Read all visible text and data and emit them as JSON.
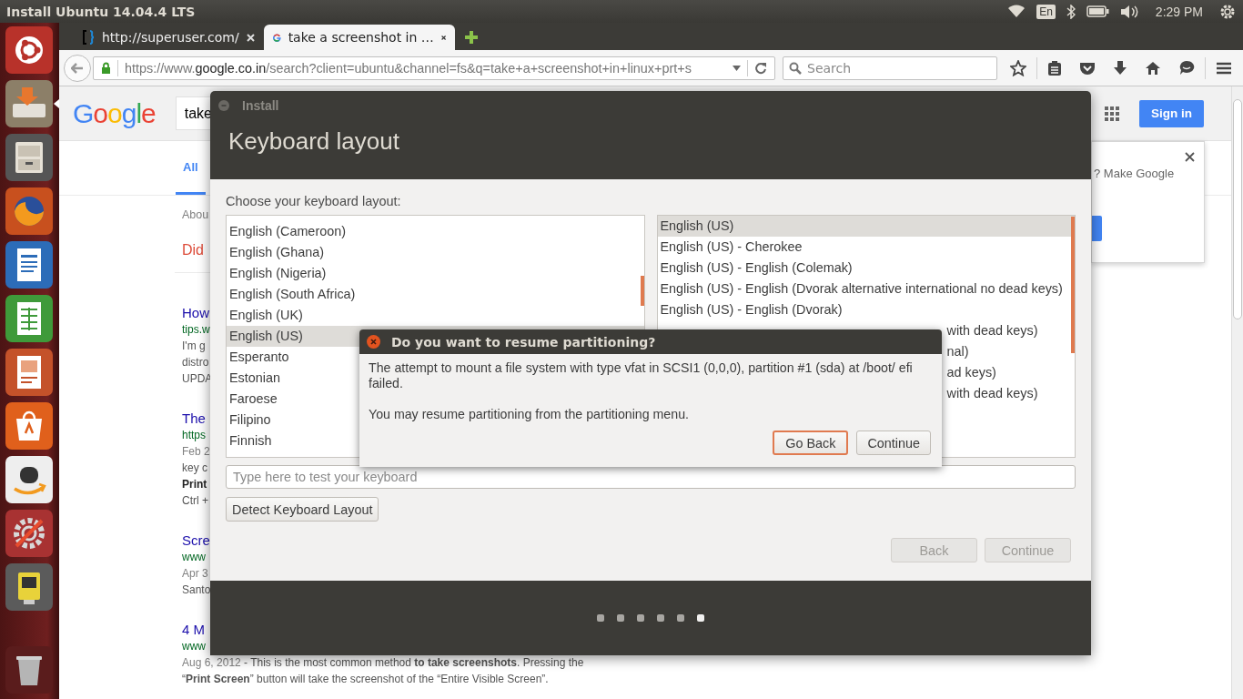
{
  "top_panel": {
    "title": "Install Ubuntu 14.04.4 LTS",
    "keyboard": "En",
    "clock": "2:29 PM"
  },
  "launcher": [
    {
      "kind": "dash",
      "focused": false
    },
    {
      "kind": "installer",
      "focused": true
    },
    {
      "kind": "files",
      "focused": false
    },
    {
      "kind": "firefox",
      "focused": false
    },
    {
      "kind": "writer",
      "focused": false
    },
    {
      "kind": "calc",
      "focused": false
    },
    {
      "kind": "impress",
      "focused": false
    },
    {
      "kind": "software",
      "focused": false
    },
    {
      "kind": "amazon",
      "focused": false
    },
    {
      "kind": "settings",
      "focused": false
    },
    {
      "kind": "drive",
      "focused": false
    },
    {
      "kind": "trash",
      "focused": false
    }
  ],
  "browser": {
    "tabs": [
      {
        "title": "http://superuser.com/",
        "selected": false
      },
      {
        "title": "take a screenshot in …",
        "selected": true
      }
    ],
    "address": {
      "scheme": "https://www.",
      "host": "google.co.in",
      "path": "/search?client=ubuntu&channel=fs&q=take+a+screenshot+in+linux+prt+s"
    },
    "search": {
      "placeholder": "Search"
    }
  },
  "google": {
    "logo": "Google",
    "query": "take",
    "sign_in": "Sign in",
    "tabs": [
      {
        "label": "All",
        "selected": true
      }
    ],
    "stats": "Abou",
    "did_you_mean": "Did",
    "results": [
      {
        "title": "How",
        "url": "tips.w",
        "lines": [
          {
            "text": "I'm g"
          },
          {
            "text": "distro"
          },
          {
            "text": "UPDA"
          }
        ]
      },
      {
        "title": "The",
        "url": "https",
        "lines": [
          {
            "date": "Feb 2"
          },
          {
            "text": "key c"
          },
          {
            "text": "Print",
            "bold": true
          },
          {
            "text": "Ctrl +"
          }
        ]
      },
      {
        "title": "Scre",
        "url": "www",
        "lines": [
          {
            "date": "Apr 3"
          },
          {
            "text": "Santo"
          }
        ]
      },
      {
        "title": "4 M",
        "url": "www",
        "lines": [
          {
            "date": "Aug 6, 2012",
            "text": " - This is the most common method **to take screenshots**. Pressing the"
          },
          {
            "text": "“**Print Screen**” button will take the screenshot of the “Entire Visible Screen”."
          }
        ]
      }
    ],
    "promo": {
      "text": "? Make Google"
    }
  },
  "installer": {
    "title": "Install",
    "heading": "Keyboard layout",
    "prompt": "Choose your keyboard layout:",
    "layouts": [
      {
        "label": "English (Cameroon)",
        "selected": false
      },
      {
        "label": "English (Ghana)",
        "selected": false
      },
      {
        "label": "English (Nigeria)",
        "selected": false
      },
      {
        "label": "English (South Africa)",
        "selected": false
      },
      {
        "label": "English (UK)",
        "selected": false
      },
      {
        "label": "English (US)",
        "selected": true
      },
      {
        "label": "Esperanto",
        "selected": false
      },
      {
        "label": "Estonian",
        "selected": false
      },
      {
        "label": "Faroese",
        "selected": false
      },
      {
        "label": "Filipino",
        "selected": false
      },
      {
        "label": "Finnish",
        "selected": false
      }
    ],
    "variants": [
      {
        "label": "English (US)",
        "selected": true,
        "kind": "row"
      },
      {
        "label": "English (US) - Cherokee",
        "selected": false,
        "kind": "row"
      },
      {
        "label": "English (US) - English (Colemak)",
        "selected": false,
        "kind": "row"
      },
      {
        "label": "English (US) - English (Dvorak alternative international no dead keys)",
        "selected": false,
        "kind": "row"
      },
      {
        "label": "English (US) - English (Dvorak)",
        "selected": false,
        "kind": "row"
      },
      {
        "label": "with dead keys)",
        "selected": false,
        "kind": "covered"
      },
      {
        "label": "nal)",
        "selected": false,
        "kind": "covered"
      },
      {
        "label": "ad keys)",
        "selected": false,
        "kind": "covered"
      },
      {
        "label": "with dead keys)",
        "selected": false,
        "kind": "covered"
      }
    ],
    "test_field": {
      "placeholder": "Type here to test your keyboard"
    },
    "detect": "Detect Keyboard Layout",
    "buttons": [
      {
        "label": "Back",
        "disabled": true
      },
      {
        "label": "Continue",
        "disabled": true
      }
    ],
    "steps": [
      {
        "selected": false
      },
      {
        "selected": false
      },
      {
        "selected": false
      },
      {
        "selected": false
      },
      {
        "selected": false
      },
      {
        "selected": true
      }
    ]
  },
  "dialog": {
    "title": "Do you want to resume partitioning?",
    "message": "The attempt to mount a file system with type vfat in SCSI1 (0,0,0), partition #1 (sda) at /boot/ efi failed.",
    "note": "You may resume partitioning from the partitioning menu.",
    "buttons": [
      {
        "label": "Go Back",
        "default": true
      },
      {
        "label": "Continue",
        "default": false
      }
    ]
  }
}
